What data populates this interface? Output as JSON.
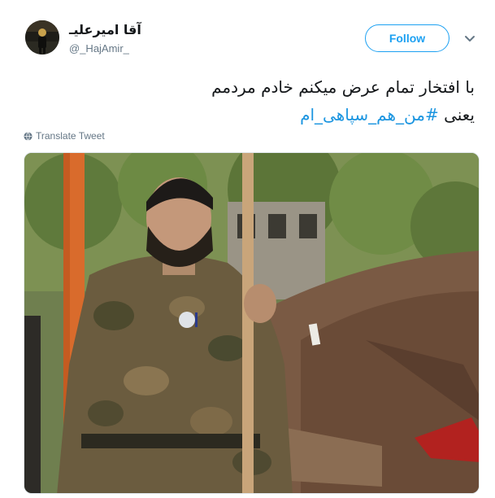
{
  "tweet": {
    "author": {
      "display_name": "آقا امیرعلیـ",
      "handle": "@_HajAmir_"
    },
    "follow_label": "Follow",
    "text": {
      "line1": "با افتخار تمام عرض میکنم خادم مردمم",
      "line2_prefix": "یعنی ",
      "hashtag": "#من_هم_سپاهی_ام"
    },
    "translate_label": "Translate Tweet",
    "icons": {
      "avatar": "avatar-photo",
      "menu": "chevron-down-icon",
      "translate": "globe-icon",
      "photo": "attached-photo"
    },
    "colors": {
      "accent": "#1da1f2",
      "hashtag": "#1b95e0",
      "text": "#14171a",
      "secondary": "#657786"
    }
  }
}
